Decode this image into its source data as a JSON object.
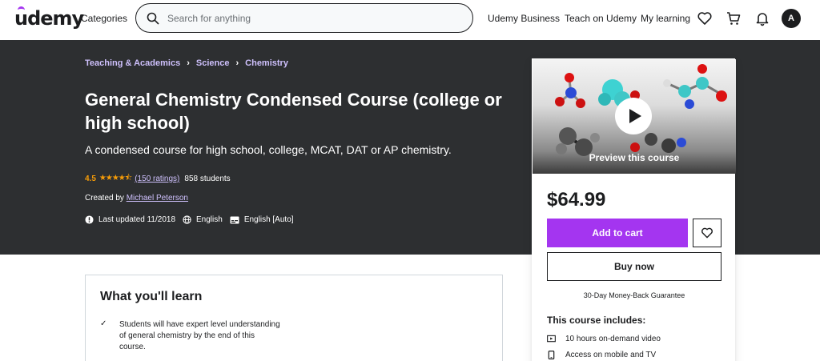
{
  "header": {
    "logo": "udemy",
    "categories": "Categories",
    "search_placeholder": "Search for anything",
    "udemy_business": "Udemy Business",
    "teach": "Teach on Udemy",
    "my_learning": "My learning",
    "avatar_initial": "A"
  },
  "breadcrumb": [
    "Teaching & Academics",
    "Science",
    "Chemistry"
  ],
  "course": {
    "title": "General Chemistry Condensed Course (college or high school)",
    "subtitle": "A condensed course for high school, college, MCAT, DAT or AP chemistry.",
    "rating": "4.5",
    "rating_stars": 4.5,
    "ratings_count": "(150 ratings)",
    "students": "858 students",
    "created_by_label": "Created by",
    "instructor": "Michael Peterson",
    "last_updated": "Last updated 11/2018",
    "language": "English",
    "captions": "English [Auto]"
  },
  "sidebar": {
    "preview_label": "Preview this course",
    "price": "$64.99",
    "add_to_cart": "Add to cart",
    "buy_now": "Buy now",
    "guarantee": "30-Day Money-Back Guarantee",
    "includes_title": "This course includes:",
    "includes": [
      {
        "icon": "video-icon",
        "label": "10 hours on-demand video"
      },
      {
        "icon": "mobile-icon",
        "label": "Access on mobile and TV"
      }
    ]
  },
  "learn": {
    "title": "What you'll learn",
    "items": [
      "Students will have expert level understanding of general chemistry by the end of this course."
    ]
  },
  "colors": {
    "accent": "#a435f0",
    "hero_bg": "#2d2f31",
    "star": "#f69c08",
    "link_light": "#cec0fc"
  }
}
